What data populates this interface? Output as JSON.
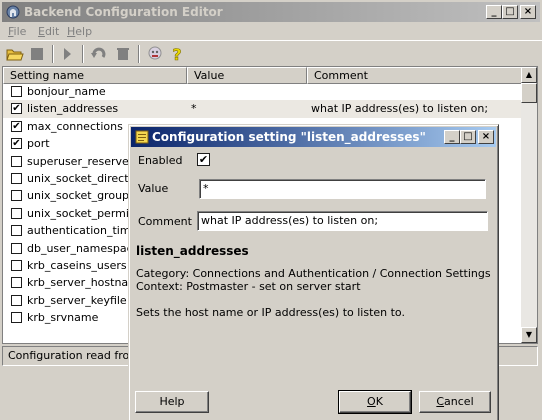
{
  "main": {
    "title": "Backend Configuration Editor",
    "menu": [
      {
        "key": "F",
        "rest": "ile"
      },
      {
        "key": "E",
        "rest": "dit"
      },
      {
        "key": "H",
        "rest": "elp"
      }
    ],
    "toolbar_icons": [
      "open-icon",
      "save-icon",
      "run-icon",
      "undo-icon",
      "delete-icon",
      "hint-icon",
      "help-icon"
    ],
    "columns": {
      "name": "Setting name",
      "value": "Value",
      "comment": "Comment"
    },
    "rows": [
      {
        "name": "bonjour_name",
        "checked": false,
        "value": "",
        "comment": ""
      },
      {
        "name": "listen_addresses",
        "checked": true,
        "value": "*",
        "comment": "what IP address(es) to listen on;"
      },
      {
        "name": "max_connections",
        "checked": true,
        "value": "",
        "comment": ""
      },
      {
        "name": "port",
        "checked": true,
        "value": "",
        "comment": ""
      },
      {
        "name": "superuser_reserved_",
        "checked": false,
        "value": "",
        "comment": ""
      },
      {
        "name": "unix_socket_director",
        "checked": false,
        "value": "",
        "comment": ""
      },
      {
        "name": "unix_socket_group",
        "checked": false,
        "value": "",
        "comment": ""
      },
      {
        "name": "unix_socket_permissi",
        "checked": false,
        "value": "",
        "comment": ""
      },
      {
        "name": "authentication_timeo",
        "checked": false,
        "value": "",
        "comment": ""
      },
      {
        "name": "db_user_namespace",
        "checked": false,
        "value": "",
        "comment": ""
      },
      {
        "name": "krb_caseins_users",
        "checked": false,
        "value": "",
        "comment": ""
      },
      {
        "name": "krb_server_hostname",
        "checked": false,
        "value": "",
        "comment": ""
      },
      {
        "name": "krb_server_keyfile",
        "checked": false,
        "value": "",
        "comment": ""
      },
      {
        "name": "krb_srvname",
        "checked": false,
        "value": "",
        "comment": ""
      }
    ],
    "status": "Configuration read from"
  },
  "dialog": {
    "title": "Configuration setting \"listen_addresses\"",
    "enabled_label": "Enabled",
    "enabled": true,
    "value_label": "Value",
    "value": "*",
    "comment_label": "Comment",
    "comment": "what IP address(es) to listen on;",
    "setting_name": "listen_addresses",
    "category": "Category: Connections and Authentication / Connection Settings",
    "context": "Context: Postmaster - set on server start",
    "description": "Sets the host name or IP address(es) to listen to.",
    "help_button": "Help",
    "ok_key": "O",
    "ok_rest": "K",
    "cancel_key": "C",
    "cancel_rest": "ancel"
  }
}
